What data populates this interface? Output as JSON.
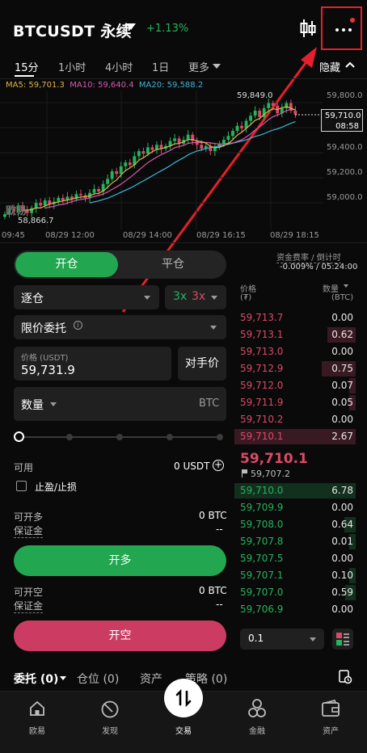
{
  "header": {
    "symbol": "BTCUSDT 永续",
    "change": "+1.13%",
    "chart_toggle_icon": "candlestick-icon",
    "more_icon": "more-dots-icon",
    "highlight_color": "#e5202c"
  },
  "timeframes": {
    "items": [
      "15分",
      "1小时",
      "4小时",
      "1日",
      "更多"
    ],
    "active": "15分",
    "hide_label": "隐藏"
  },
  "chart": {
    "ma": [
      {
        "label": "MA5: 59,701.3",
        "color": "#e0b34a"
      },
      {
        "label": "MA10: 59,640.4",
        "color": "#d65ab0"
      },
      {
        "label": "MA20: 59,588.2",
        "color": "#3fb5d8"
      }
    ],
    "price_ticks": [
      "59,800.0",
      "59,600.0",
      "59,400.0",
      "59,200.0",
      "59,000.0"
    ],
    "time_ticks": [
      "09:45",
      "08/29 12:00",
      "08/29 14:00",
      "08/29 16:15",
      "08/29 18:15"
    ],
    "high_label": "59,849.0",
    "low_label": "58,866.7",
    "current_price": "59,710.0",
    "countdown": "08:58",
    "watermark": "欧易"
  },
  "chart_data": {
    "type": "candlestick",
    "ylim": [
      58800,
      59900
    ],
    "ma_values": {
      "MA5": 59701.3,
      "MA10": 59640.4,
      "MA20": 59588.2
    },
    "high": 59849.0,
    "low": 58866.7,
    "last": 59710.0
  },
  "order_form": {
    "mode_open": "开仓",
    "mode_close": "平仓",
    "margin_mode": "逐仓",
    "leverage_long": "3x",
    "leverage_short": "3x",
    "order_type": "限价委托",
    "price_label": "价格 (USDT)",
    "price_value": "59,731.9",
    "counterparty_btn": "对手价",
    "qty_label": "数量",
    "qty_unit": "BTC",
    "available_label": "可用",
    "available_value": "0 USDT",
    "tpsl_label": "止盈/止损",
    "can_long_label": "可开多",
    "can_long_value": "0 BTC",
    "margin_label": "保证金",
    "margin_long_value": "--",
    "long_btn": "开多",
    "can_short_label": "可开空",
    "can_short_value": "0 BTC",
    "margin_short_value": "--",
    "short_btn": "开空"
  },
  "orderbook": {
    "funding_label": "资金费率 / 倒计时",
    "funding_value": "-0.009% / 05:24:00",
    "price_header": "价格",
    "price_unit": "(₮)",
    "qty_header": "数量",
    "qty_unit": "(BTC)",
    "asks": [
      {
        "price": "59,713.7",
        "qty": "0.00"
      },
      {
        "price": "59,713.1",
        "qty": "0.62"
      },
      {
        "price": "59,713.0",
        "qty": "0.00"
      },
      {
        "price": "59,712.9",
        "qty": "0.75"
      },
      {
        "price": "59,712.0",
        "qty": "0.07"
      },
      {
        "price": "59,711.9",
        "qty": "0.05"
      },
      {
        "price": "59,710.2",
        "qty": "0.00"
      },
      {
        "price": "59,710.1",
        "qty": "2.67"
      }
    ],
    "last_price": "59,710.1",
    "mark_price": "59,707.2",
    "bids": [
      {
        "price": "59,710.0",
        "qty": "6.78"
      },
      {
        "price": "59,709.9",
        "qty": "0.00"
      },
      {
        "price": "59,708.0",
        "qty": "0.64"
      },
      {
        "price": "59,707.8",
        "qty": "0.01"
      },
      {
        "price": "59,707.5",
        "qty": "0.00"
      },
      {
        "price": "59,707.1",
        "qty": "0.10"
      },
      {
        "price": "59,707.0",
        "qty": "0.59"
      },
      {
        "price": "59,706.9",
        "qty": "0.00"
      }
    ],
    "depth_step": "0.1"
  },
  "bottom_tabs": {
    "orders": "委托 (0)",
    "positions": "仓位 (0)",
    "assets": "资产",
    "strategy": "策略 (0)"
  },
  "nav": {
    "items": [
      {
        "label": "欧易",
        "icon": "home-icon"
      },
      {
        "label": "发现",
        "icon": "discover-icon"
      },
      {
        "label": "交易",
        "icon": "trade-icon"
      },
      {
        "label": "金融",
        "icon": "finance-icon"
      },
      {
        "label": "资产",
        "icon": "wallet-icon"
      }
    ]
  }
}
